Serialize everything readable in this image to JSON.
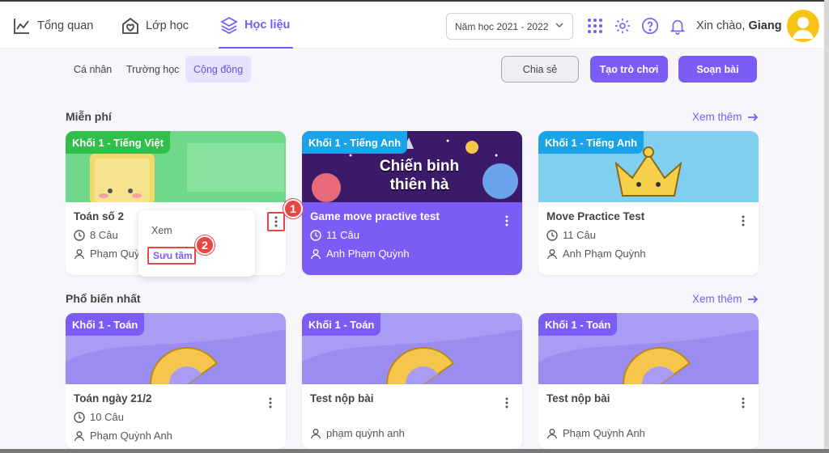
{
  "nav": {
    "overview": "Tổng quan",
    "classes": "Lớp học",
    "materials": "Học liệu",
    "school_year": "Năm học 2021 - 2022",
    "greeting": "Xin chào,",
    "user_name": "Giang"
  },
  "subtabs": [
    "Cá nhân",
    "Trường học",
    "Cộng đồng"
  ],
  "actions": {
    "share": "Chia sẻ",
    "create_game": "Tạo trò chơi",
    "compose": "Soạn bài"
  },
  "sections": {
    "free": {
      "title": "Miễn phí",
      "see_more": "Xem thêm"
    },
    "popular": {
      "title": "Phổ biến nhất",
      "see_more": "Xem thêm"
    }
  },
  "free_cards": [
    {
      "tag": "Khối 1 - Tiếng Việt",
      "title": "Toán số 2",
      "count": "8 Câu",
      "author": "Phạm Quỳnh Anh"
    },
    {
      "tag": "Khối 1 - Tiếng Anh",
      "title": "Game move practive test",
      "count": "11 Câu",
      "author": "Anh Phạm Quỳnh",
      "banner_line1": "Chiến binh",
      "banner_line2": "thiên hà"
    },
    {
      "tag": "Khối 1 - Tiếng Anh",
      "title": "Move Practice Test",
      "count": "11 Câu",
      "author": "Anh Phạm Quỳnh"
    }
  ],
  "popular_cards": [
    {
      "tag": "Khối 1 - Toán",
      "title": "Toán ngày 21/2",
      "count": "10 Câu",
      "author": "Phạm Quỳnh Anh"
    },
    {
      "tag": "Khối 1 - Toán",
      "title": "Test nộp bài",
      "count": "",
      "author": "phạm quỳnh anh"
    },
    {
      "tag": "Khối 1 - Toán",
      "title": "Test nộp bài",
      "count": "",
      "author": "Phạm Quỳnh Anh"
    }
  ],
  "popup": {
    "view": "Xem",
    "collect": "Sưu tầm"
  },
  "markers": [
    "1",
    "2"
  ],
  "colors": {
    "accent": "#7b5cf5",
    "tag_green": "#2fbf4a",
    "tag_blue": "#1aa3e8",
    "tag_purple": "#7b5cf5",
    "highlight": "#e84545"
  }
}
